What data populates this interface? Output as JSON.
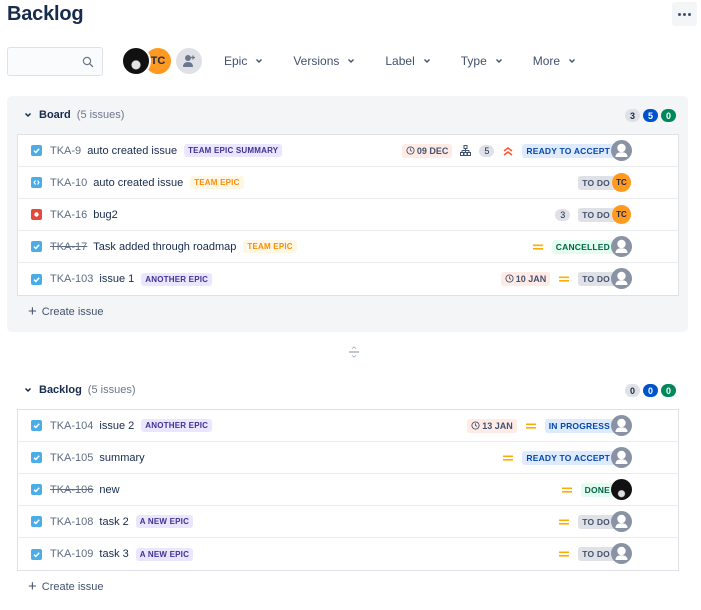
{
  "page": {
    "title": "Backlog",
    "more_actions_icon": "ellipsis-icon"
  },
  "toolbar": {
    "search": {
      "value": "",
      "placeholder": "",
      "icon": "search-icon"
    },
    "avatars": [
      {
        "type": "photo",
        "name": "cat-avatar"
      },
      {
        "type": "initials",
        "initials": "TC",
        "color": "#ff991f"
      }
    ],
    "add_people_icon": "add-user-icon",
    "filters": [
      {
        "label": "Epic"
      },
      {
        "label": "Versions"
      },
      {
        "label": "Label"
      },
      {
        "label": "Type"
      },
      {
        "label": "More"
      }
    ]
  },
  "sections": [
    {
      "name": "Board",
      "issue_count_label": "(5 issues)",
      "counts": {
        "todo": "3",
        "in_progress": "5",
        "done": "0"
      },
      "create_label": "Create issue",
      "issues": [
        {
          "type": "task",
          "key": "TKA-9",
          "done": false,
          "summary": "auto created issue",
          "epic": "TEAM EPIC SUMMARY",
          "epic_color": "purple",
          "due": "09 DEC",
          "child_issues": true,
          "estimate": "5",
          "priority": "highest",
          "status": "READY TO ACCEPT",
          "status_color": "blue",
          "assignee": "unassigned"
        },
        {
          "type": "subtask",
          "key": "TKA-10",
          "done": false,
          "summary": "auto created issue",
          "epic": "TEAM EPIC",
          "epic_color": "orange",
          "due": null,
          "estimate": null,
          "priority": null,
          "status": "TO DO",
          "status_color": "grey",
          "assignee": "TC"
        },
        {
          "type": "bug",
          "key": "TKA-16",
          "done": false,
          "summary": "bug2",
          "epic": null,
          "due": null,
          "estimate": "3",
          "priority": null,
          "status": "TO DO",
          "status_color": "grey",
          "assignee": "TC"
        },
        {
          "type": "task",
          "key": "TKA-17",
          "done": true,
          "summary": "Task added through roadmap",
          "epic": "TEAM EPIC",
          "epic_color": "orange",
          "due": null,
          "estimate": null,
          "priority": "medium",
          "status": "CANCELLED",
          "status_color": "green",
          "assignee": "unassigned"
        },
        {
          "type": "task",
          "key": "TKA-103",
          "done": false,
          "summary": "issue 1",
          "epic": "ANOTHER EPIC",
          "epic_color": "purple",
          "due": "10 JAN",
          "estimate": null,
          "priority": "medium",
          "status": "TO DO",
          "status_color": "grey",
          "assignee": "unassigned"
        }
      ]
    },
    {
      "name": "Backlog",
      "issue_count_label": "(5 issues)",
      "counts": {
        "todo": "0",
        "in_progress": "0",
        "done": "0"
      },
      "create_label": "Create issue",
      "issues": [
        {
          "type": "task",
          "key": "TKA-104",
          "done": false,
          "summary": "issue 2",
          "epic": "ANOTHER EPIC",
          "epic_color": "purple",
          "due": "13 JAN",
          "estimate": null,
          "priority": "medium",
          "status": "IN PROGRESS",
          "status_color": "blue",
          "assignee": "unassigned"
        },
        {
          "type": "task",
          "key": "TKA-105",
          "done": false,
          "summary": "summary",
          "epic": null,
          "due": null,
          "estimate": null,
          "priority": "medium",
          "status": "READY TO ACCEPT",
          "status_color": "blue",
          "assignee": "unassigned"
        },
        {
          "type": "task",
          "key": "TKA-106",
          "done": true,
          "summary": "new",
          "epic": null,
          "due": null,
          "estimate": null,
          "priority": "medium",
          "status": "DONE",
          "status_color": "green",
          "assignee": "cat"
        },
        {
          "type": "task",
          "key": "TKA-108",
          "done": false,
          "summary": "task 2",
          "epic": "A NEW EPIC",
          "epic_color": "purple",
          "due": null,
          "estimate": null,
          "priority": "medium",
          "status": "TO DO",
          "status_color": "grey",
          "assignee": "unassigned"
        },
        {
          "type": "task",
          "key": "TKA-109",
          "done": false,
          "summary": "task 3",
          "epic": "A NEW EPIC",
          "epic_color": "purple",
          "due": null,
          "estimate": null,
          "priority": "medium",
          "status": "TO DO",
          "status_color": "grey",
          "assignee": "unassigned"
        }
      ]
    }
  ]
}
